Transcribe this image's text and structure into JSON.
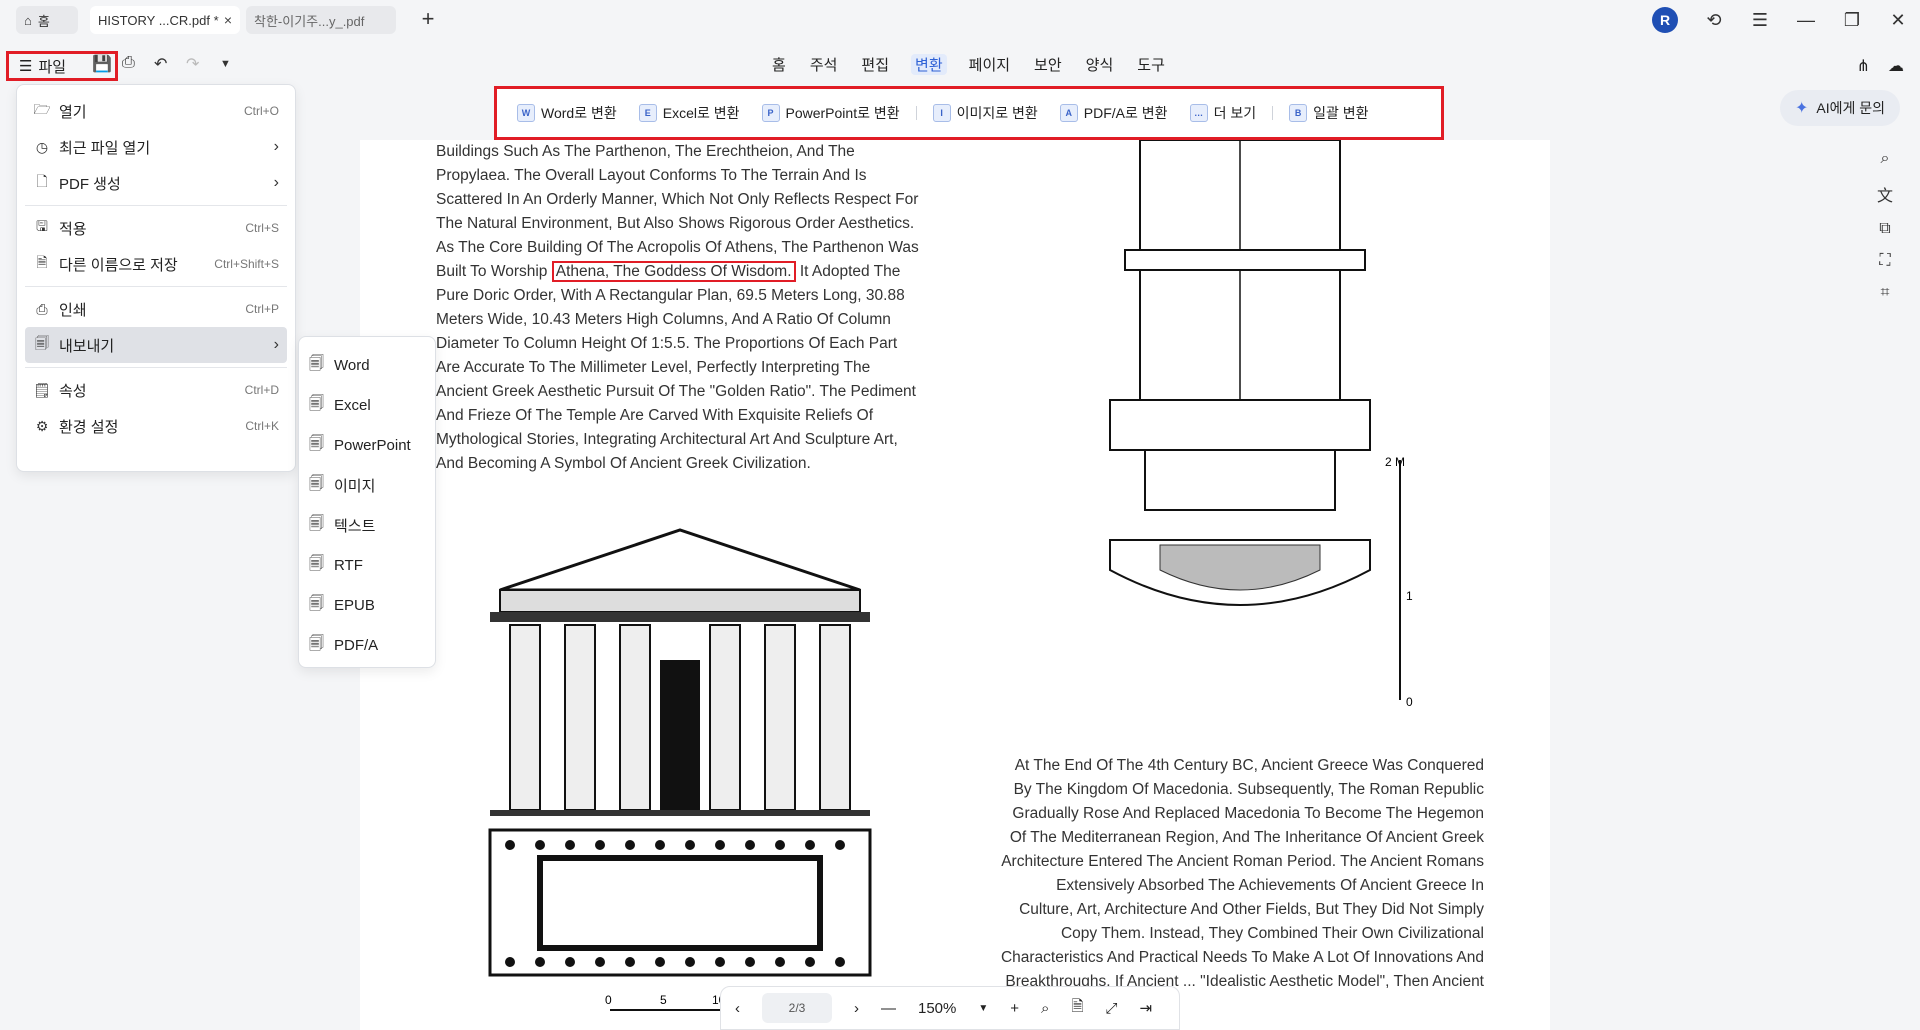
{
  "tabs": {
    "home_label": "홈",
    "items": [
      {
        "label": "HISTORY ...CR.pdf *"
      },
      {
        "label": "착한-이기주...y_.pdf"
      }
    ],
    "new_tab": "+"
  },
  "titlebar": {
    "avatar_initial": "R"
  },
  "toolbar": {
    "file_label": "파일",
    "menu_tabs": [
      "홈",
      "주석",
      "편집",
      "변환",
      "페이지",
      "보안",
      "양식",
      "도구"
    ],
    "active_tab": "변환"
  },
  "convert_ribbon": {
    "items": [
      {
        "label": "Word로 변환",
        "icon": "W"
      },
      {
        "label": "Excel로 변환",
        "icon": "E"
      },
      {
        "label": "PowerPoint로 변환",
        "icon": "P"
      },
      {
        "label": "이미지로 변환",
        "icon": "I"
      },
      {
        "label": "PDF/A로 변환",
        "icon": "A"
      },
      {
        "label": "더 보기",
        "icon": "…"
      },
      {
        "label": "일괄 변환",
        "icon": "B"
      }
    ]
  },
  "ask_ai": {
    "label": "AI에게 문의"
  },
  "file_menu": {
    "items": [
      {
        "label": "열기",
        "shortcut": "Ctrl+O",
        "icon": "folder-icon"
      },
      {
        "label": "최근 파일 열기",
        "arrow": true,
        "icon": "clock-icon"
      },
      {
        "label": "PDF 생성",
        "arrow": true,
        "icon": "file-plus-icon"
      },
      {
        "label": "적용",
        "shortcut": "Ctrl+S",
        "icon": "save-icon"
      },
      {
        "label": "다른 이름으로 저장",
        "shortcut": "Ctrl+Shift+S",
        "icon": "save-as-icon"
      },
      {
        "label": "인쇄",
        "shortcut": "Ctrl+P",
        "icon": "print-icon"
      },
      {
        "label": "내보내기",
        "arrow": true,
        "icon": "export-icon"
      },
      {
        "label": "속성",
        "shortcut": "Ctrl+D",
        "icon": "properties-icon"
      },
      {
        "label": "환경 설정",
        "shortcut": "Ctrl+K",
        "icon": "settings-icon"
      }
    ]
  },
  "export_submenu": {
    "items": [
      "Word",
      "Excel",
      "PowerPoint",
      "이미지",
      "텍스트",
      "RTF",
      "EPUB",
      "PDF/A"
    ]
  },
  "document": {
    "left_text_before": "Buildings Such As The Parthenon, The Erechtheion, And The Propylaea. The Overall Layout Conforms To The Terrain And Is Scattered In An Orderly Manner, Which Not Only Reflects Respect For The Natural Environment, But Also Shows Rigorous Order Aesthetics. As The Core Building Of The Acropolis Of Athens, The Parthenon Was Built To Worship ",
    "left_text_highlight": "Athena, The Goddess Of Wisdom.",
    "left_text_after": " It Adopted The Pure Doric Order, With A Rectangular Plan, 69.5 Meters Long, 30.88 Meters Wide, 10.43 Meters High Columns, And A Ratio Of Column Diameter To Column Height Of 1:5.5. The Proportions Of Each Part Are Accurate To The Millimeter Level, Perfectly Interpreting The Ancient Greek Aesthetic Pursuit Of The \"Golden Ratio\". The Pediment And Frieze Of The Temple Are Carved With Exquisite Reliefs Of Mythological Stories, Integrating Architectural Art And Sculpture Art, And Becoming A Symbol Of Ancient Greek Civilization.",
    "right_text": "At The End Of The 4th Century BC, Ancient Greece Was Conquered By The Kingdom Of Macedonia. Subsequently, The Roman Republic Gradually Rose And Replaced Macedonia To Become The Hegemon Of The Mediterranean Region, And The Inheritance Of Ancient Greek Architecture Entered The Ancient Roman Period. The Ancient Romans Extensively Absorbed The Achievements Of Ancient Greece In Culture, Art, Architecture And Other Fields, But They Did Not Simply Copy Them. Instead, They Combined Their Own Civilizational Characteristics And Practical Needs To Make A Lot Of Innovations And Breakthroughs. If Ancient ... \"Idealistic Aesthetic Model\", Then Ancient",
    "scale_labels": [
      "0",
      "5",
      "10"
    ],
    "column_scale": [
      "2 M",
      "1",
      "0"
    ]
  },
  "bottom_nav": {
    "page_indicator": "2/3",
    "zoom": "150%"
  }
}
